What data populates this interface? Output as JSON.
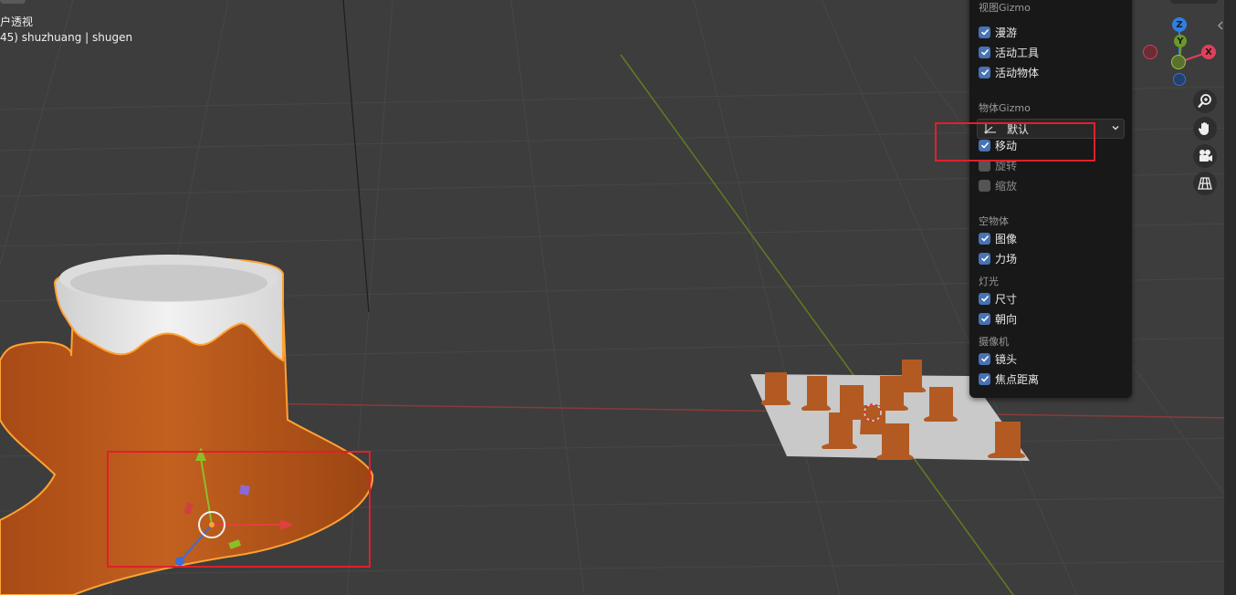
{
  "viewport": {
    "view_name": "户透视",
    "object_info": "45) shuzhuang | shugen"
  },
  "gizmo_panel": {
    "viewport_gizmo_heading": "视图Gizmo",
    "viewport_gizmo_items": [
      {
        "label": "漫游",
        "checked": true
      },
      {
        "label": "活动工具",
        "checked": true
      },
      {
        "label": "活动物体",
        "checked": true
      }
    ],
    "object_gizmo_heading": "物体Gizmo",
    "orientation_dropdown": {
      "label": "默认",
      "icon": "transform-orientation-icon"
    },
    "object_gizmo_items": [
      {
        "label": "移动",
        "checked": true
      },
      {
        "label": "旋转",
        "checked": false
      },
      {
        "label": "缩放",
        "checked": false
      }
    ],
    "empty_heading": "空物体",
    "empty_items": [
      {
        "label": "图像",
        "checked": true
      },
      {
        "label": "力场",
        "checked": true
      }
    ],
    "light_heading": "灯光",
    "light_items": [
      {
        "label": "尺寸",
        "checked": true
      },
      {
        "label": "朝向",
        "checked": true
      }
    ],
    "camera_heading": "摄像机",
    "camera_items": [
      {
        "label": "镜头",
        "checked": true
      },
      {
        "label": "焦点距离",
        "checked": true
      }
    ]
  },
  "navigation_gizmo": {
    "axes": [
      {
        "label": "Z",
        "color": "#2f7fe0"
      },
      {
        "label": "Y",
        "color": "#6a9a2a"
      },
      {
        "label": "X",
        "color": "#e0405a"
      }
    ],
    "buttons": [
      "zoom-icon",
      "hand-pan-icon",
      "camera-icon",
      "perspective-grid-icon"
    ]
  },
  "colors": {
    "viewport_bg": "#3d3d3d",
    "panel_bg": "#181818",
    "checkbox_on": "#4772b3",
    "stump_brown": "#b5561c",
    "snow": "#e8e8e8",
    "selection_outline": "#ffa233",
    "annotation_red": "#e0202a",
    "x_axis": "#d03a3a",
    "y_axis": "#8bbf2a"
  }
}
